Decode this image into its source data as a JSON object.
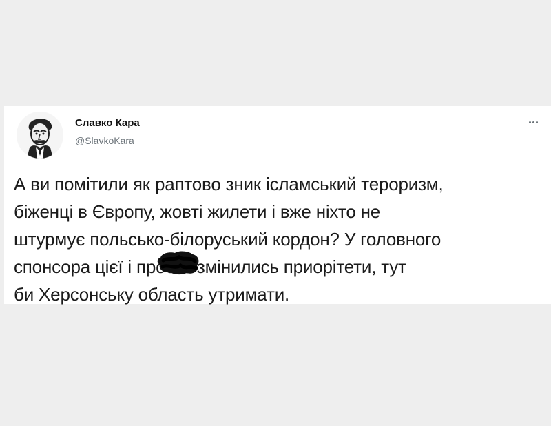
{
  "tweet": {
    "author_name": "Славко Кара",
    "author_handle": "@SlavkoKara",
    "more_icon": "more-horizontal-icon",
    "avatar_icon": "portrait-avatar-icon",
    "text": "А ви помітили як раптово зник ісламський тероризм,\nбіженці в Європу, жовті жилети і вже ніхто не\nштурмує польсько-білоруський кордон? У головного\nспонсора цієї            і просто змінились приорітети, тут\nби Херсонську область утримати."
  },
  "colors": {
    "background": "#eeeeee",
    "card": "#ffffff",
    "text": "#1b1b1b",
    "muted": "#6b7379",
    "redaction": "#111111"
  }
}
